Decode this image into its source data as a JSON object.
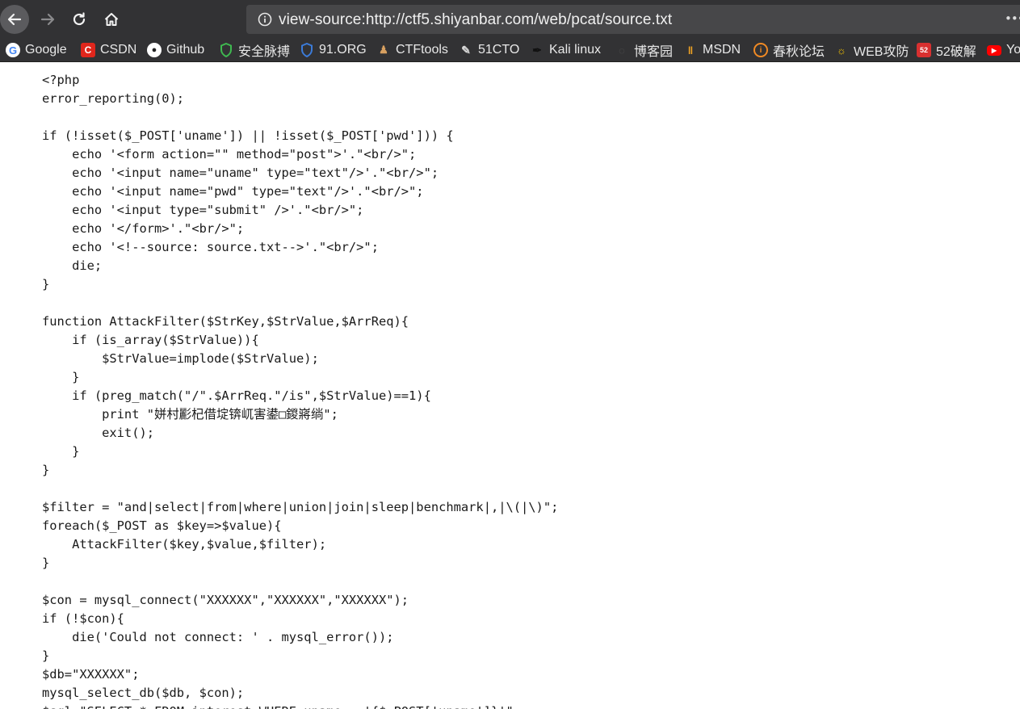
{
  "browser": {
    "url": "view-source:http://ctf5.shiyanbar.com/web/pcat/source.txt",
    "menu_dots": "•••",
    "bookmarks": [
      {
        "label": "Google",
        "icon": "google-icon",
        "color": "#4285f4"
      },
      {
        "label": "CSDN",
        "icon": "csdn-icon",
        "color": "#e0261c"
      },
      {
        "label": "Github",
        "icon": "github-icon",
        "color": "#ffffff"
      },
      {
        "label": "安全脉搏",
        "icon": "shield-icon",
        "color": "#3fb950"
      },
      {
        "label": "91.ORG",
        "icon": "shield-icon",
        "color": "#3b7bd9"
      },
      {
        "label": "CTFtools",
        "icon": "ninja-icon",
        "color": "#b07030"
      },
      {
        "label": "51CTO",
        "icon": "wrench-icon",
        "color": "#cccccc"
      },
      {
        "label": "Kali linux",
        "icon": "dragon-icon",
        "color": "#222222"
      },
      {
        "label": "博客园",
        "icon": "blog-icon",
        "color": "#555555"
      },
      {
        "label": "MSDN",
        "icon": "msdn-icon",
        "color": "#f5a623"
      },
      {
        "label": "春秋论坛",
        "icon": "chunqiu-icon",
        "color": "#f08a24"
      },
      {
        "label": "WEB攻防",
        "icon": "web-icon",
        "color": "#f5c400"
      },
      {
        "label": "52破解",
        "icon": "crack-icon",
        "color": "#d83030"
      },
      {
        "label": "Yo",
        "icon": "youtube-icon",
        "color": "#ff0000"
      }
    ]
  },
  "source": {
    "lines": [
      "<?php",
      "error_reporting(0);",
      "",
      "if (!isset($_POST['uname']) || !isset($_POST['pwd'])) {",
      "    echo '<form action=\"\" method=\"post\">'.\"<br/>\";",
      "    echo '<input name=\"uname\" type=\"text\"/>'.\"<br/>\";",
      "    echo '<input name=\"pwd\" type=\"text\"/>'.\"<br/>\";",
      "    echo '<input type=\"submit\" />'.\"<br/>\";",
      "    echo '</form>'.\"<br/>\";",
      "    echo '<!--source: source.txt-->'.\"<br/>\";",
      "    die;",
      "}",
      "",
      "function AttackFilter($StrKey,$StrValue,$ArrReq){",
      "    if (is_array($StrValue)){",
      "        $StrValue=implode($StrValue);",
      "    }",
      "    if (preg_match(\"/\".$ArrReq.\"/is\",$StrValue)==1){",
      "        print \"姘村彲杞借埞锛屼害鍙□鍐嶈绱\";",
      "        exit();",
      "    }",
      "}",
      "",
      "$filter = \"and|select|from|where|union|join|sleep|benchmark|,|\\(|\\)\";",
      "foreach($_POST as $key=>$value){",
      "    AttackFilter($key,$value,$filter);",
      "}",
      "",
      "$con = mysql_connect(\"XXXXXX\",\"XXXXXX\",\"XXXXXX\");",
      "if (!$con){",
      "    die('Could not connect: ' . mysql_error());",
      "}",
      "$db=\"XXXXXX\";",
      "mysql_select_db($db, $con);",
      "$sql=\"SELECT * FROM interest WHERE uname = '{$_POST['uname']}'\";"
    ]
  }
}
